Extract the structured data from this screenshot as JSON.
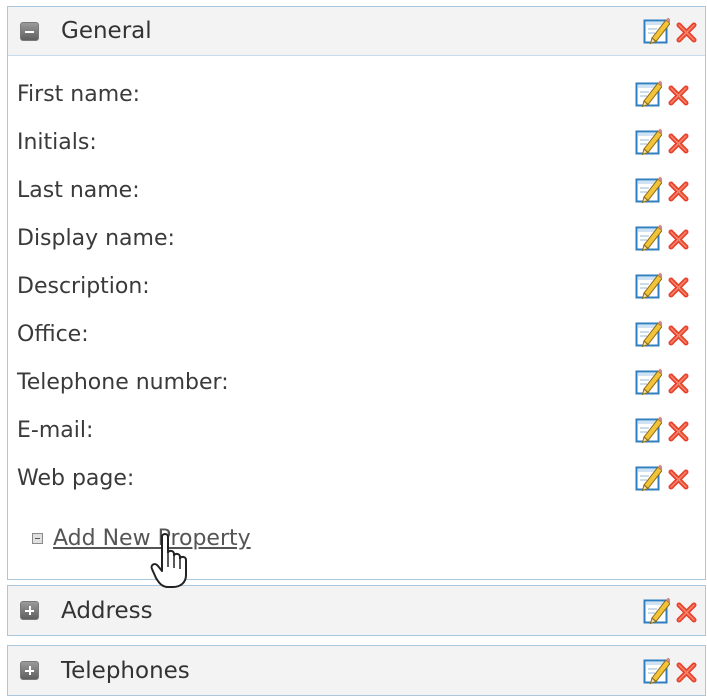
{
  "sections": {
    "general": {
      "title": "General",
      "expanded": true,
      "properties": [
        {
          "label": "First name:"
        },
        {
          "label": "Initials:"
        },
        {
          "label": "Last name:"
        },
        {
          "label": "Display name:"
        },
        {
          "label": "Description:"
        },
        {
          "label": "Office:"
        },
        {
          "label": "Telephone number:"
        },
        {
          "label": "E-mail:"
        },
        {
          "label": "Web page:"
        }
      ],
      "add_property_label": "Add New Property"
    },
    "address": {
      "title": "Address",
      "expanded": false
    },
    "telephones": {
      "title": "Telephones",
      "expanded": false
    }
  },
  "icons": {
    "edit": "pencil-edit-icon",
    "delete": "red-x-delete-icon",
    "collapse": "minus-box-icon",
    "expand": "plus-box-icon",
    "cursor": "hand-pointer-cursor"
  },
  "colors": {
    "section_border": "#a9c8de",
    "header_bg": "#f3f3f3",
    "delete_red": "#e8412c",
    "edit_blue": "#2e7fc1",
    "pencil_yellow": "#f3c33a"
  }
}
